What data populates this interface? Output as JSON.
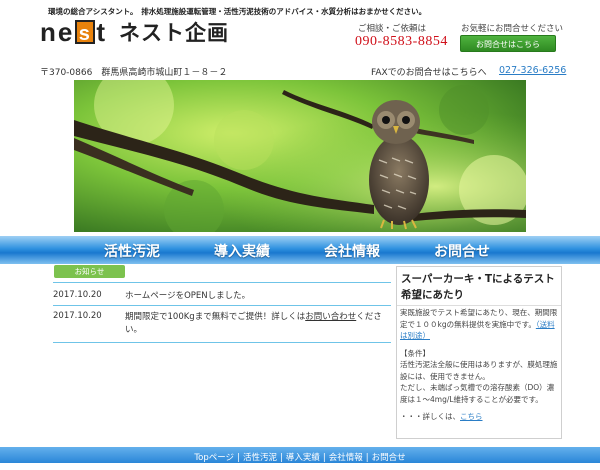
{
  "header": {
    "tagline": "環境の総合アシスタント。　排水処理施設運転管理・活性汚泥技術のアドバイス・水質分析はおまかせください。",
    "logo_en_1": "ne",
    "logo_en_s": "s",
    "logo_en_2": "t",
    "logo_jp": "ネスト企画",
    "contact_label": "ご相談・ご依頼は",
    "phone": "090-8583-8854",
    "casual_label": "お気軽にお問合せください",
    "inquiry_button": "お問合せはこちら",
    "address": "〒370-0866　群馬県高崎市城山町１－８－２",
    "fax_label": "FAXでのお問合せはこちらへ",
    "fax_number": "027-326-6256"
  },
  "nav": {
    "items": [
      "活性汚泥",
      "導入実績",
      "会社情報",
      "お問合せ"
    ]
  },
  "news": {
    "badge": "お知らせ",
    "items": [
      {
        "date": "2017.10.20",
        "text": "ホームページをOPENしました。"
      },
      {
        "date": "2017.10.20",
        "text_before": "期間限定で100Kgまで無料でご提供！詳しくは",
        "link": "お問い合わせ",
        "text_after": "ください。"
      }
    ]
  },
  "sidebar": {
    "title": "スーパーカーキ・Tによるテスト希望にあたり",
    "p1": "実既施設でテスト希望にあたり、現在、期間限定で１００kgの無料提供を実施中です。",
    "p1_link": "（送料は別途）",
    "cond_title": "【条件】",
    "cond1": "活性汚泥法全般に使用はありますが、膜処理施設には、使用できません。",
    "cond2": "ただし、未端ばっ気槽での溶存酸素（DO）濃度は１～4mg/L維持することが必要です。",
    "more_prefix": "・・・詳しくは、",
    "more_link": "こちら"
  },
  "footer": {
    "items": [
      "Topページ",
      "活性汚泥",
      "導入実績",
      "会社情報",
      "お問合せ"
    ],
    "separator": "|"
  },
  "icons": {
    "hero": "owl-on-branch-photo"
  },
  "colors": {
    "phone": "#d0101a",
    "accent_green": "#4fb33f",
    "nav_blue": "#1a78cf",
    "link_blue": "#2a7dc6",
    "logo_orange": "#e8820c"
  }
}
